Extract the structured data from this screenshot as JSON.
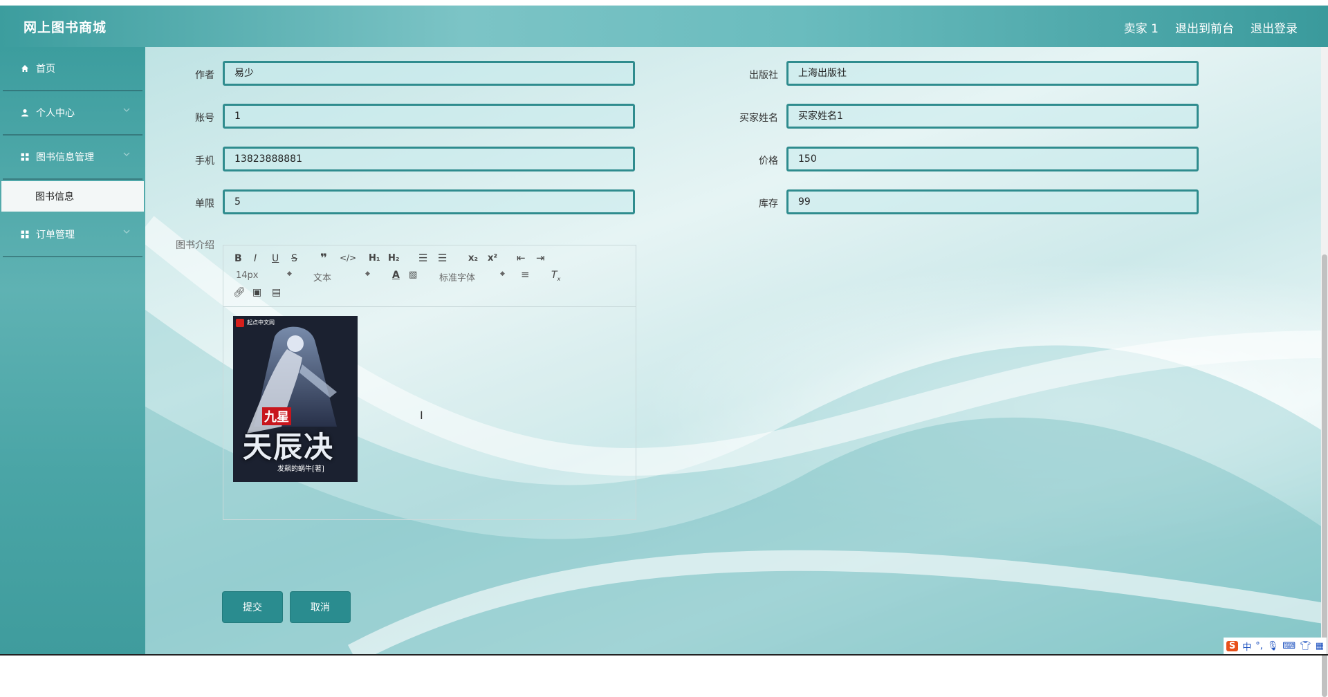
{
  "header": {
    "brand": "网上图书商城",
    "links": [
      "卖家 1",
      "退出到前台",
      "退出登录"
    ]
  },
  "sidebar": {
    "items": [
      {
        "label": "首页",
        "icon": "home-icon"
      },
      {
        "label": "个人中心",
        "icon": "user-icon"
      },
      {
        "label": "图书信息管理",
        "icon": "grid-icon"
      },
      {
        "label": "订单管理",
        "icon": "grid-icon"
      }
    ],
    "sub_item": "图书信息"
  },
  "form": {
    "author_label": "作者",
    "author_value": "易少",
    "publisher_label": "出版社",
    "publisher_value": "上海出版社",
    "account_label": "账号",
    "account_value": "1",
    "buyer_label": "买家姓名",
    "buyer_value": "买家姓名1",
    "phone_label": "手机",
    "phone_value": "13823888881",
    "price_label": "价格",
    "price_value": "150",
    "limit_label": "单限",
    "limit_value": "5",
    "stock_label": "库存",
    "stock_value": "99",
    "intro_label": "图书介绍"
  },
  "editor": {
    "font_size": "14px",
    "format": "文本",
    "font_family": "标准字体"
  },
  "cover": {
    "site": "起点中文网",
    "title_top": "九星",
    "title_main": "天辰决",
    "author": "发飙的蜗牛[著]"
  },
  "buttons": {
    "submit": "提交",
    "cancel": "取消"
  },
  "ime": {
    "lang": "中"
  },
  "colors": {
    "accent": "#2a8c8f",
    "header": "#5db3b5"
  }
}
